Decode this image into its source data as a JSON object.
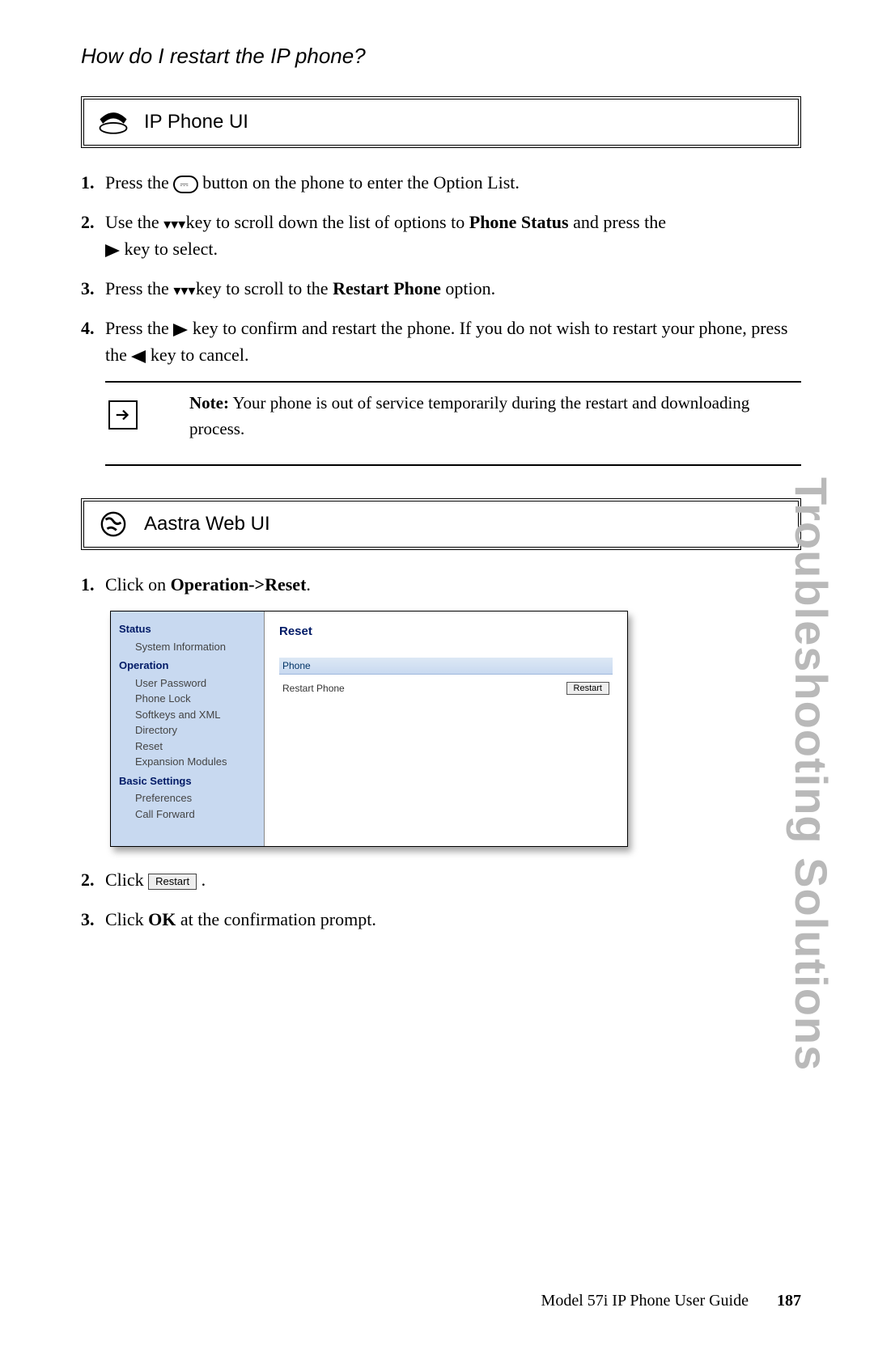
{
  "heading": "How do I restart the IP phone?",
  "section1": {
    "title": "IP Phone UI"
  },
  "steps1": {
    "s1_a": "Press the ",
    "s1_b": " button on the phone to enter the Option List.",
    "s2_a": "Use the ",
    "s2_b": " key to scroll down the list of options to ",
    "s2_bold": "Phone Status",
    "s2_c": " and press the ",
    "s2_d": " key to select.",
    "s3_a": "Press the ",
    "s3_b": " key to scroll to the ",
    "s3_bold": "Restart Phone",
    "s3_c": " option.",
    "s4_a": "Press the ",
    "s4_b": " key to confirm and restart the phone. If you do not wish to restart your phone, press the ",
    "s4_c": " key to cancel."
  },
  "note": {
    "label": "Note:",
    "text": " Your phone is out of service temporarily during the restart and downloading process."
  },
  "section2": {
    "title": "Aastra Web UI"
  },
  "steps2": {
    "s1_a": "Click on ",
    "s1_bold": "Operation->Reset",
    "s1_b": ".",
    "s2_a": "Click ",
    "s2_btn": "Restart",
    "s2_b": " .",
    "s3_a": "Click ",
    "s3_bold": "OK",
    "s3_b": " at the confirmation prompt."
  },
  "webui": {
    "sidebar": {
      "g1": "Status",
      "g1_items": [
        "System Information"
      ],
      "g2": "Operation",
      "g2_items": [
        "User Password",
        "Phone Lock",
        "Softkeys and XML",
        "Directory",
        "Reset",
        "Expansion Modules"
      ],
      "g3": "Basic Settings",
      "g3_items": [
        "Preferences",
        "Call Forward"
      ]
    },
    "main": {
      "title": "Reset",
      "sub": "Phone",
      "row_label": "Restart Phone",
      "row_btn": "Restart"
    }
  },
  "sideTab": "Troubleshooting Solutions",
  "footer": {
    "guide": "Model 57i IP Phone User Guide",
    "page": "187"
  }
}
